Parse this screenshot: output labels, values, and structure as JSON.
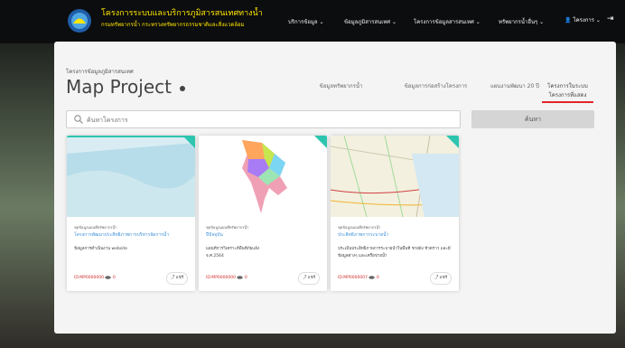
{
  "header": {
    "brand_title": "โครงการระบบและบริการภูมิสารสนเทศทางน้ำ",
    "brand_subtitle": "กรมทรัพยากรน้ำ กระทรวงทรัพยากรธรรมชาติและสิ่งแวดล้อม",
    "nav_items": [
      "บริการข้อมูล ⌄",
      "ข้อมูลภูมิสารสนเทศ ⌄",
      "โครงการข้อมูลสารสนเทศ ⌄",
      "ทรัพยากรน้ำอื่นๆ ⌄"
    ],
    "user_label": "โครงการ ⌄",
    "exit_icon": "logout-icon",
    "accent_color": "#ffe600"
  },
  "page": {
    "breadcrumb": "โครงการข้อมูลภูมิสารสนเทศ",
    "title": "Map Project",
    "title_icon": "info-dot-icon"
  },
  "tabs": [
    {
      "label": "ข้อมูลทรัพยากรน้ำ"
    },
    {
      "label": "ข้อมูลการก่อสร้างโครงการ"
    },
    {
      "label": "แผนงานพัฒนา 20 ปี"
    },
    {
      "label": "โครงการในระบบ\nโครงการที่แสดง",
      "active": true
    }
  ],
  "search": {
    "placeholder": "ค้นหาโครงการ",
    "button_label": "ค้นหา",
    "icon": "search-icon"
  },
  "cards": [
    {
      "category": "ชุดข้อมูลแผนที่ทรัพยากรน้ำ",
      "title": "โครงการพัฒนาประสิทธิภาพการบริหารจัดการน้ำ",
      "description": "ข้อมูลการดำเนินงาน website",
      "id": "ID:MP0000000",
      "views": "0",
      "share_label": "แชร์"
    },
    {
      "category": "ชุดข้อมูลแผนที่ทรัพยากรน้ำ",
      "title": "ปีปัจจุบัน",
      "description": "แผนที่การวิเคราะห์พื้นที่ภัยแล้ง\nจ.ศ.2564",
      "id": "ID:MP0000000",
      "views": "0",
      "share_label": "แชร์"
    },
    {
      "category": "ชุดข้อมูลแผนที่ทรัพยากรน้ำ",
      "title": "ประสิทธิภาพการระบายน้ำ",
      "description": "ประเมินประสิทธิภาพการระบายน้ำในพื้นที่ ชายฝั่ง ชั่วคราว และมีข้อมูลต่างๆ และเครือข่ายน้ำ",
      "id": "ID:MP0000007",
      "views": "0",
      "share_label": "แชร์"
    }
  ],
  "colors": {
    "accent_red": "#e2262a",
    "link_blue": "#3c8fd8",
    "badge_green": "#2ec5af"
  }
}
